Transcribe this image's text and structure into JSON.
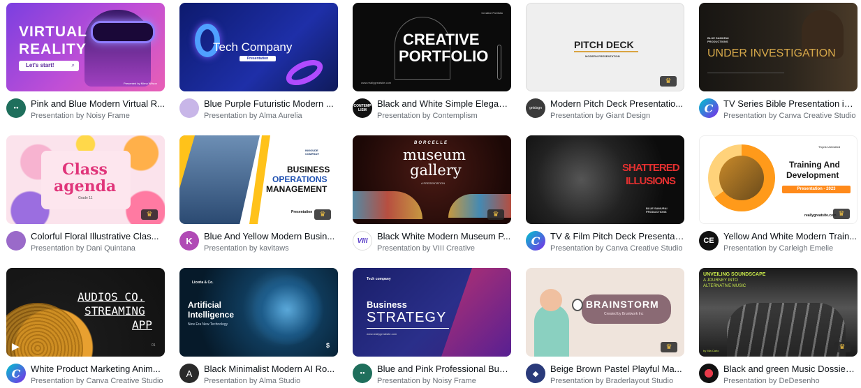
{
  "colors": {
    "title": "#0e1318",
    "author": "#6b7178",
    "crown": "#f5c544"
  },
  "cards": [
    {
      "title": "Pink and Blue Modern Virtual R...",
      "author": "Presentation by Noisy Frame",
      "thumb": {
        "line1": "VIRTUAL",
        "line2": "REALITY",
        "button": "Let's start!",
        "footer": "Presented by Mirna Wilson"
      }
    },
    {
      "title": "Blue Purple Futuristic Modern ...",
      "author": "Presentation by Alma Aurelia",
      "thumb": {
        "line1": "Tech Company",
        "sub": "Presentation"
      }
    },
    {
      "title": "Black and White Simple Elegan...",
      "author": "Presentation by Contemplism",
      "avatar_text": "CONTEMP LISM",
      "thumb": {
        "line1": "CREATIVE",
        "line2": "PORTFOLIO",
        "corner": "Creative Portfolio",
        "footer": "www.reallygreatsite.com"
      }
    },
    {
      "title": "Modern Pitch Deck Presentatio...",
      "author": "Presentation by Giant Design",
      "avatar_text": "gntdsgn",
      "thumb": {
        "line1": "PITCH DECK",
        "sub": "MODERN PRESENTATION"
      }
    },
    {
      "title": "TV Series Bible Presentation in ...",
      "author": "Presentation by Canva Creative Studio",
      "thumb": {
        "line1": "UNDER INVESTIGATION",
        "brand": "BLUE SAMURAI PRODUCTIONS"
      }
    },
    {
      "title": "Colorful Floral Illustrative Clas...",
      "author": "Presentation by Dani Quintana",
      "thumb": {
        "line1": "Class",
        "line2": "agenda",
        "sub": "Grade 11"
      }
    },
    {
      "title": "Blue And Yellow Modern Busin...",
      "author": "Presentation by kavitaws",
      "thumb": {
        "line1": "BUSINESS",
        "line2": "OPERATIONS",
        "line3": "MANAGEMENT",
        "brand": "INGOUDE COMPANY",
        "footer": "Presentation"
      }
    },
    {
      "title": "Black White Modern Museum P...",
      "author": "Presentation by VIII Creative",
      "thumb": {
        "brand": "BORCELLE",
        "line1": "museum",
        "line2": "gallery",
        "sub": "A PRESENTATION"
      }
    },
    {
      "title": "TV & Film Pitch Deck Presentati...",
      "author": "Presentation by Canva Creative Studio",
      "thumb": {
        "line1": "SHATTERED",
        "line2": "ILLUSIONS",
        "brand": "BLUE SAMURAI PRODUCTIONS"
      }
    },
    {
      "title": "Yellow And White Modern Train...",
      "author": "Presentation by Carleigh Emelie",
      "thumb": {
        "brand": "Thynk Unlimited",
        "line1": "Training And",
        "line2": "Development",
        "badge": "Presentation - 2023",
        "footer": "reallygreatsite.com"
      }
    },
    {
      "title": "White Product Marketing Anim...",
      "author": "Presentation by Canva Creative Studio",
      "thumb": {
        "line1": "AUDIOS CO.",
        "line2": "STREAMING",
        "line3": "APP",
        "footer": "01"
      }
    },
    {
      "title": "Black Minimalist Modern AI Ro...",
      "author": "Presentation by Alma Studio",
      "thumb": {
        "brand": "Liceria & Co.",
        "line1": "Artificial",
        "line2": "Intelligence",
        "sub": "New Era New Technology"
      }
    },
    {
      "title": "Blue and Pink Professional Bus...",
      "author": "Presentation by Noisy Frame",
      "thumb": {
        "brand": "Tech company",
        "line1": "Business",
        "line2": "STRATEGY",
        "footer": "www.reallygreatsite.com"
      }
    },
    {
      "title": "Beige Brown Pastel Playful Ma...",
      "author": "Presentation by Braderlayout Studio",
      "thumb": {
        "line1": "BRAINSTORM",
        "sub": "Created by Bruntwork Inc"
      }
    },
    {
      "title": "Black and green Music Dossier ...",
      "author": "Presentation by DeDesenho",
      "thumb": {
        "line1": "UNVEILING SOUNDSCAPE",
        "line2": "A JOURNEY INTO",
        "line3": "ALTERNATIVE MUSIC",
        "footer": "by Mia Carlo"
      }
    }
  ],
  "avatar_text": {
    "noisy": "Noisy Frame"
  }
}
